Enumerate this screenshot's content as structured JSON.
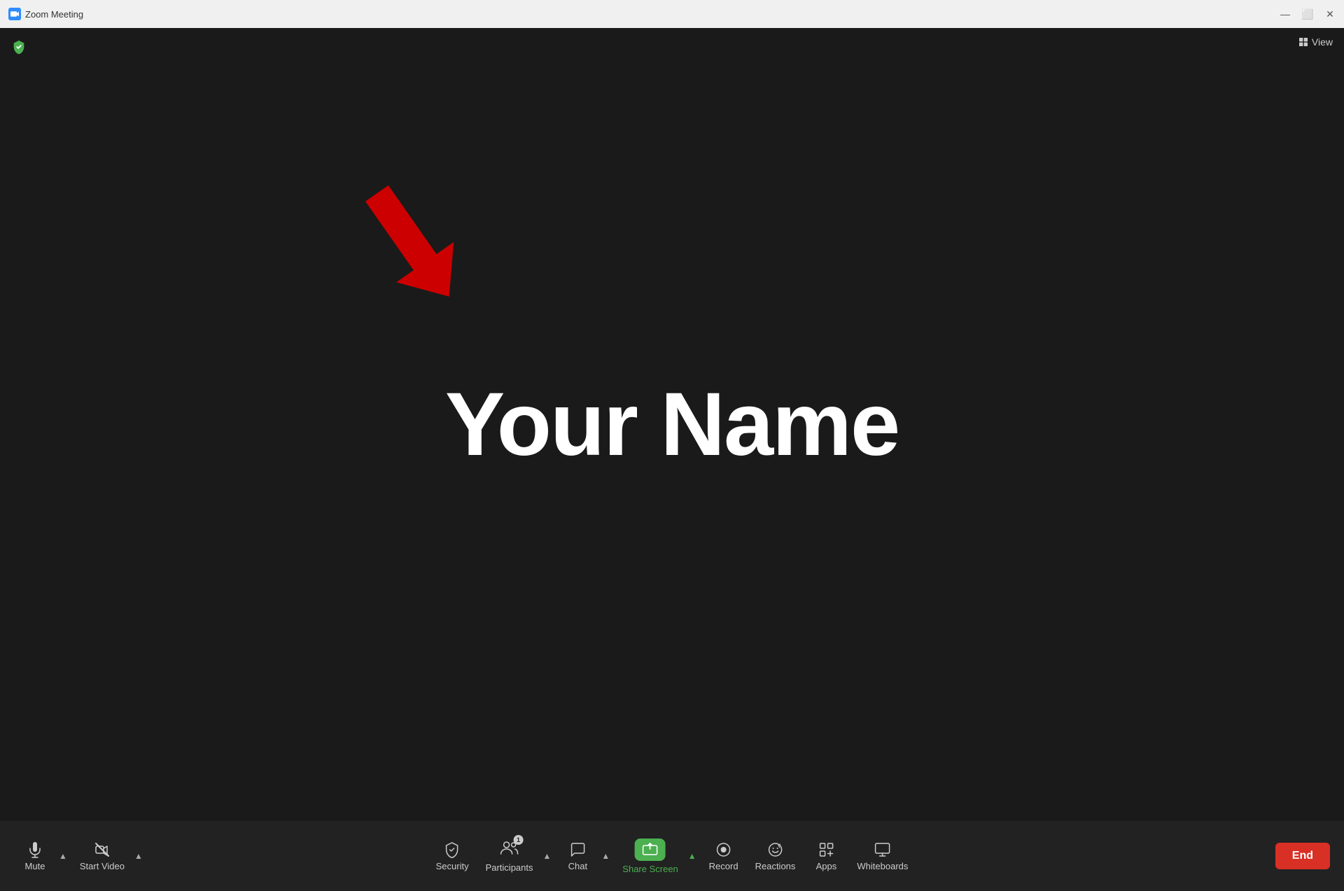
{
  "titleBar": {
    "title": "Zoom Meeting",
    "logoAlt": "Zoom logo",
    "controls": {
      "minimize": "—",
      "maximize": "⬜",
      "close": "✕"
    },
    "viewLabel": "View"
  },
  "mainArea": {
    "participantName": "Your Name",
    "shieldColor": "#4caf50"
  },
  "toolbar": {
    "items": [
      {
        "id": "mute",
        "label": "Mute",
        "icon": "mic"
      },
      {
        "id": "start-video",
        "label": "Start Video",
        "icon": "video-off"
      },
      {
        "id": "security",
        "label": "Security",
        "icon": "shield"
      },
      {
        "id": "participants",
        "label": "Participants",
        "icon": "people",
        "badge": "1"
      },
      {
        "id": "chat",
        "label": "Chat",
        "icon": "chat"
      },
      {
        "id": "share-screen",
        "label": "Share Screen",
        "icon": "share",
        "active": true
      },
      {
        "id": "record",
        "label": "Record",
        "icon": "record"
      },
      {
        "id": "reactions",
        "label": "Reactions",
        "icon": "emoji"
      },
      {
        "id": "apps",
        "label": "Apps",
        "icon": "apps"
      },
      {
        "id": "whiteboards",
        "label": "Whiteboards",
        "icon": "whiteboard"
      }
    ],
    "endLabel": "End",
    "endColor": "#d93025"
  }
}
